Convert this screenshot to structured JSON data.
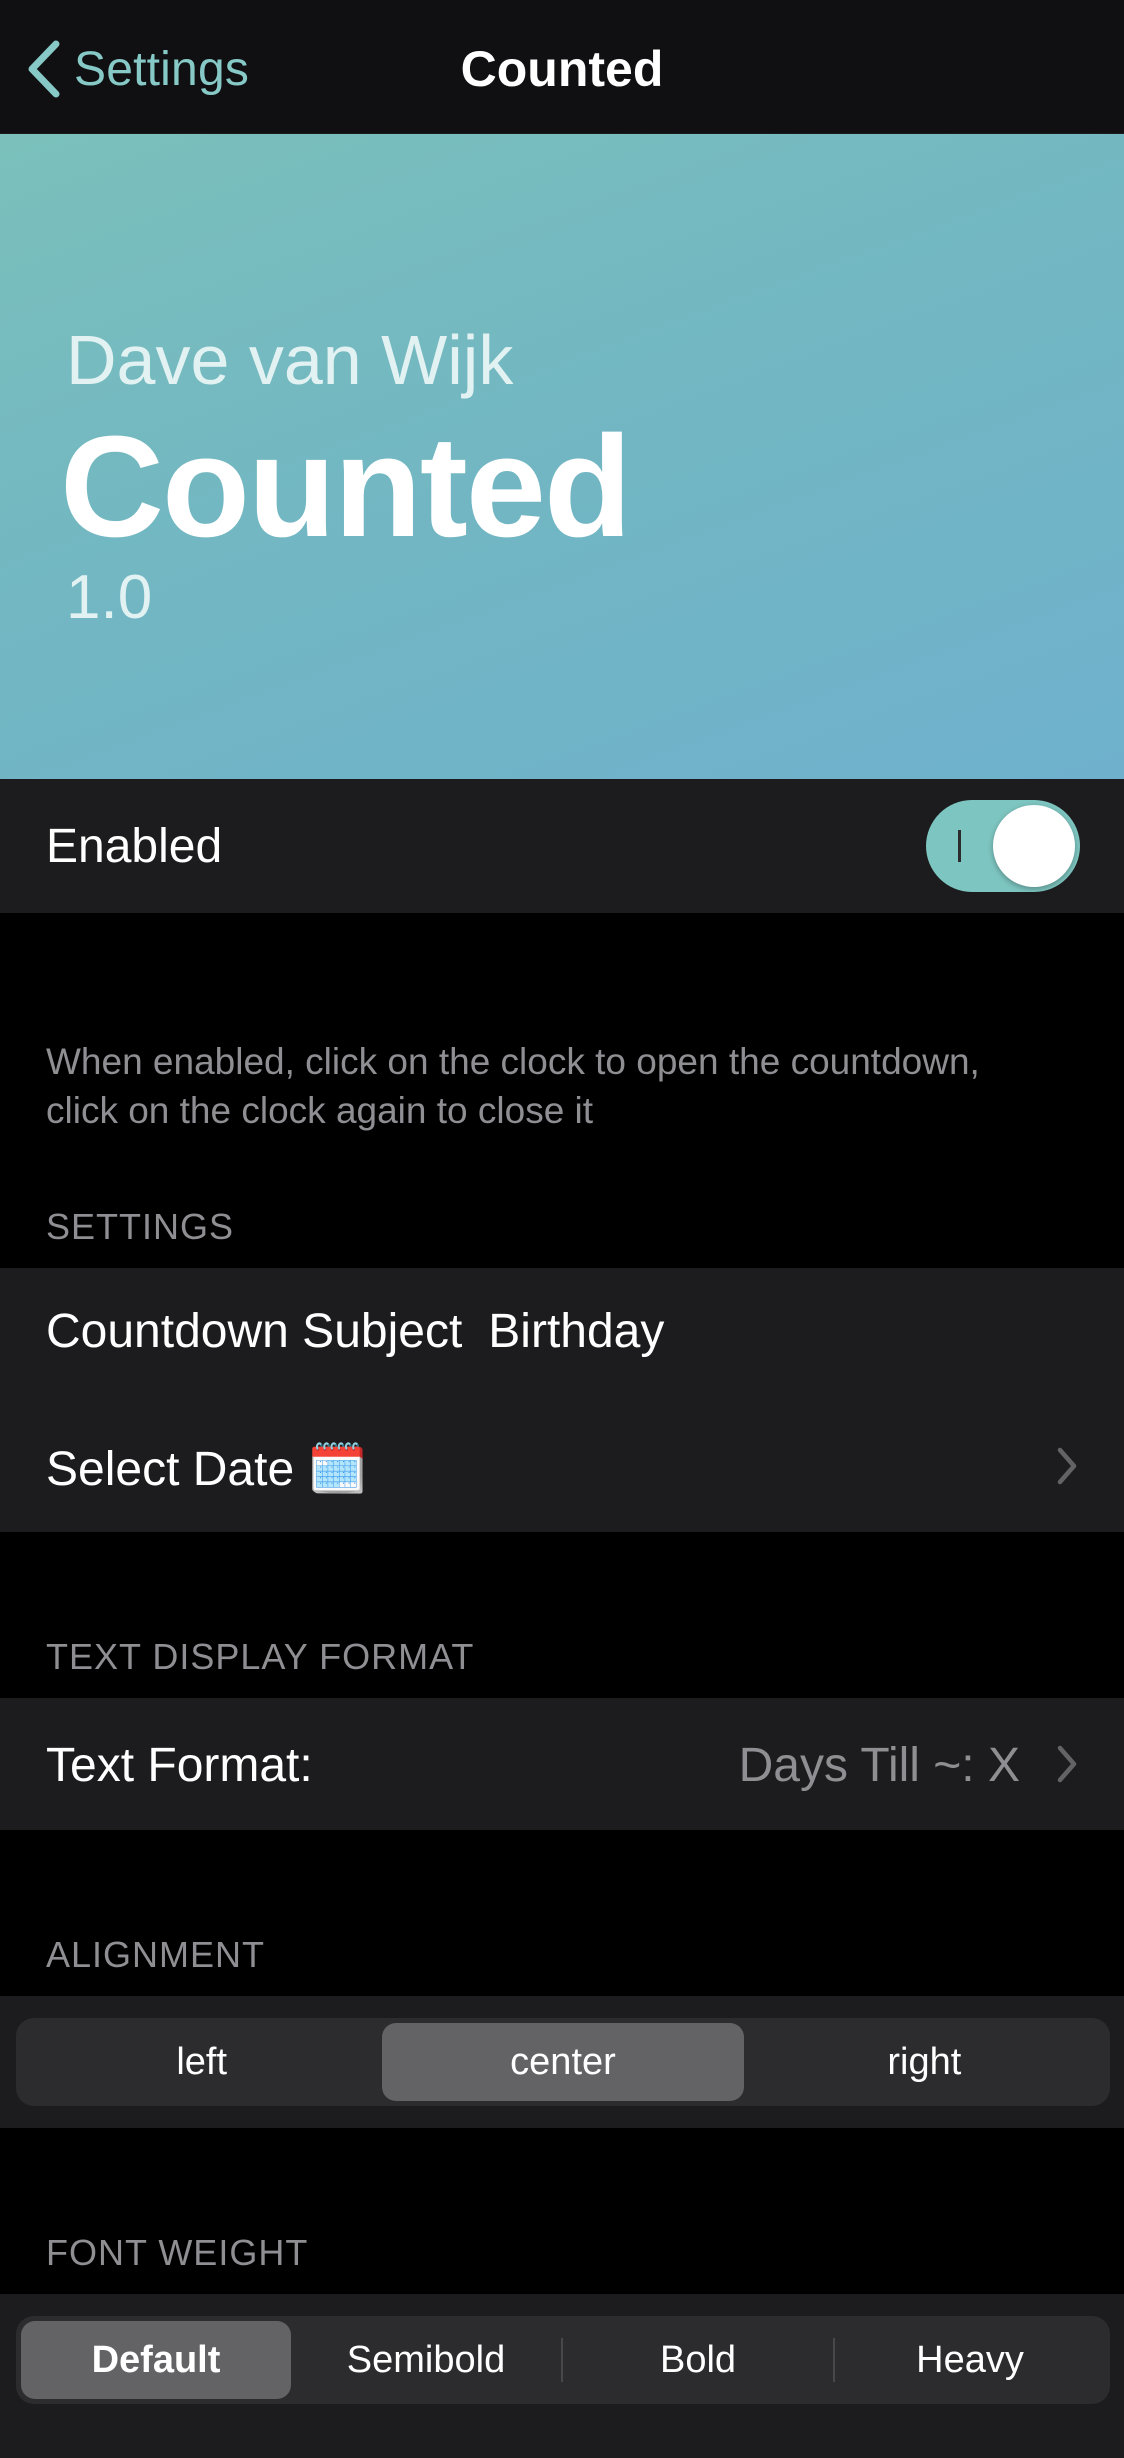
{
  "nav": {
    "back_label": "Settings",
    "title": "Counted"
  },
  "banner": {
    "author": "Dave van Wijk",
    "name": "Counted",
    "version": "1.0"
  },
  "enabled": {
    "label": "Enabled",
    "on": true,
    "footer": "When enabled, click on the clock to open the countdown, click on the clock again to close it"
  },
  "settings": {
    "header": "SETTINGS",
    "subject_label": "Countdown Subject",
    "subject_value": "Birthday",
    "select_date_label": "Select Date 🗓️"
  },
  "text_display": {
    "header": "TEXT DISPLAY FORMAT",
    "label": "Text Format:",
    "value": "Days Till ~: X"
  },
  "alignment": {
    "header": "ALIGNMENT",
    "options": [
      "left",
      "center",
      "right"
    ],
    "selected": "center"
  },
  "font_weight": {
    "header": "FONT WEIGHT",
    "options": [
      "Default",
      "Semibold",
      "Bold",
      "Heavy"
    ],
    "selected": "Default"
  },
  "colors": {
    "accent": "#7dc5c0",
    "banner_start": "#7bc0bb",
    "banner_end": "#6fb1cd",
    "cell_background": "#1c1c1e",
    "secondary_text": "#8e8e93"
  }
}
